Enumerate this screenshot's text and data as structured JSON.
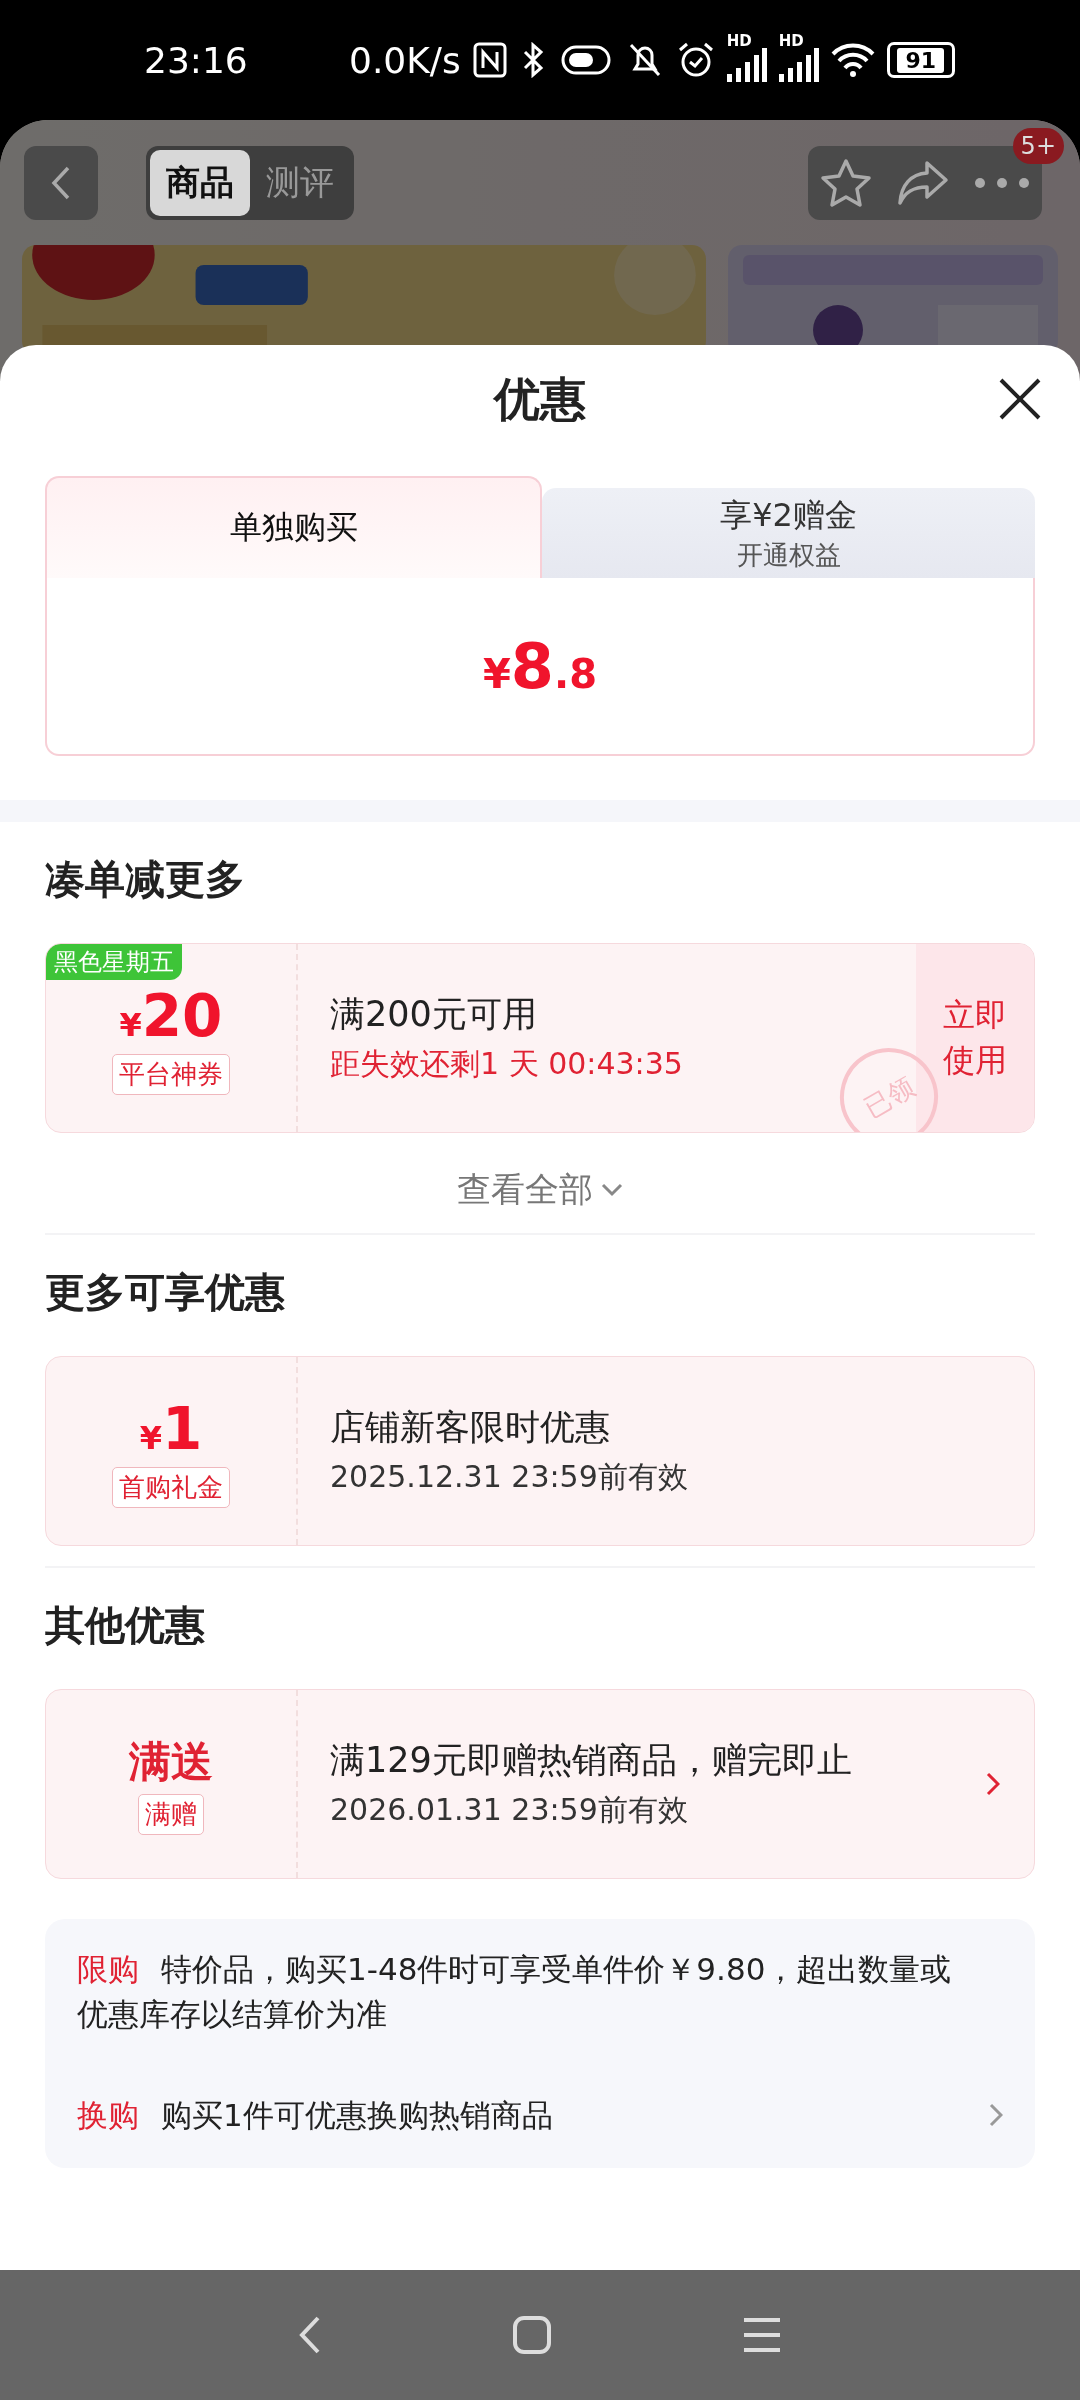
{
  "status_bar": {
    "time": "23:16",
    "speed": "0.0K/s",
    "signal_labels": [
      "HD",
      "HD"
    ],
    "battery": "91"
  },
  "page_header": {
    "tabs": [
      {
        "label": "商品",
        "selected": true
      },
      {
        "label": "测评",
        "selected": false
      }
    ],
    "badge": "5+"
  },
  "sheet": {
    "title": "优惠",
    "price_tabs": [
      {
        "title": "单独购买",
        "selected": true
      },
      {
        "title": "享¥2赠金",
        "subtitle": "开通权益",
        "selected": false
      }
    ],
    "price": {
      "symbol": "¥",
      "integer": "8",
      "decimal": ".8"
    }
  },
  "sections": [
    {
      "title": "凑单减更多",
      "coupons": [
        {
          "kind": "amount",
          "tag": "黑色星期五",
          "currency": "¥",
          "amount": "20",
          "label": "平台神券",
          "condition": "满200元可用",
          "detail": "距失效还剩1 天 00:43:35",
          "urgent": true,
          "action": "立即使用",
          "stamp": "已领",
          "has_arrow": false
        }
      ],
      "more": "查看全部"
    },
    {
      "title": "更多可享优惠",
      "coupons": [
        {
          "kind": "amount",
          "currency": "¥",
          "amount": "1",
          "label": "首购礼金",
          "condition": "店铺新客限时优惠",
          "detail": "2025.12.31 23:59前有效",
          "urgent": false,
          "has_arrow": false
        }
      ]
    },
    {
      "title": "其他优惠",
      "coupons": [
        {
          "kind": "text",
          "headline": "满送",
          "label": "满赠",
          "condition": "满129元即赠热销商品，赠完即止",
          "detail": "2026.01.31 23:59前有效",
          "urgent": false,
          "has_arrow": true
        }
      ]
    }
  ],
  "rules": [
    {
      "tag": "限购",
      "text": "特价品，购买1-48件时可享受单件价￥9.80，超出数量或优惠库存以结算价为准",
      "has_arrow": false
    },
    {
      "tag": "换购",
      "text": "购买1件可优惠换购热销商品",
      "has_arrow": true
    }
  ]
}
